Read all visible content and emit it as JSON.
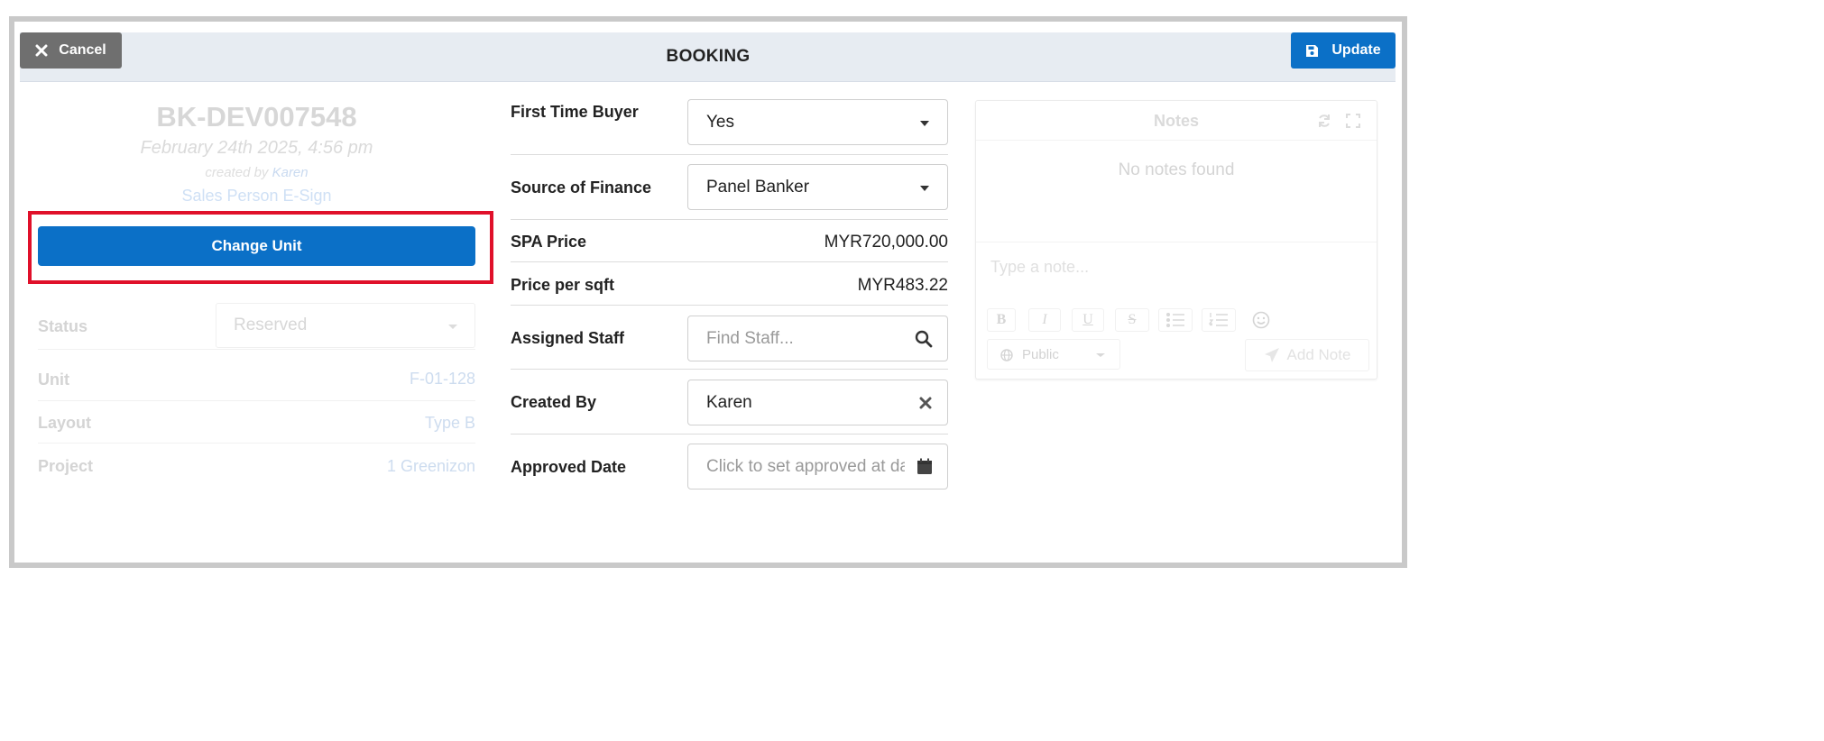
{
  "header": {
    "title": "BOOKING",
    "cancel_label": "Cancel",
    "update_label": "Update"
  },
  "booking": {
    "id": "BK-DEV007548",
    "date": "February 24th 2025, 4:56 pm",
    "created_by_prefix": "created by",
    "created_by_name": "Karen",
    "esign_link": "Sales Person E-Sign",
    "change_unit_label": "Change Unit"
  },
  "details": {
    "status_label": "Status",
    "status_value": "Reserved",
    "unit_label": "Unit",
    "unit_value": "F-01-128",
    "layout_label": "Layout",
    "layout_value": "Type B",
    "project_label": "Project",
    "project_value": "1 Greenizon"
  },
  "form": {
    "first_time_buyer_label": "First Time Buyer",
    "first_time_buyer_value": "Yes",
    "source_of_finance_label": "Source of Finance",
    "source_of_finance_value": "Panel Banker",
    "spa_price_label": "SPA Price",
    "spa_price_value": "MYR720,000.00",
    "price_per_sqft_label": "Price per sqft",
    "price_per_sqft_value": "MYR483.22",
    "assigned_staff_label": "Assigned Staff",
    "assigned_staff_placeholder": "Find Staff...",
    "created_by_label": "Created By",
    "created_by_value": "Karen",
    "approved_date_label": "Approved Date",
    "approved_date_placeholder": "Click to set approved at date"
  },
  "notes": {
    "title": "Notes",
    "empty_text": "No notes found",
    "input_placeholder": "Type a note...",
    "toolbar": {
      "bold": "B",
      "italic": "I",
      "underline": "U",
      "strike": "S"
    },
    "visibility_value": "Public",
    "add_note_label": "Add Note"
  },
  "colors": {
    "primary": "#0b70c7",
    "cancel": "#6f6f6f",
    "highlight": "#e0102a"
  }
}
